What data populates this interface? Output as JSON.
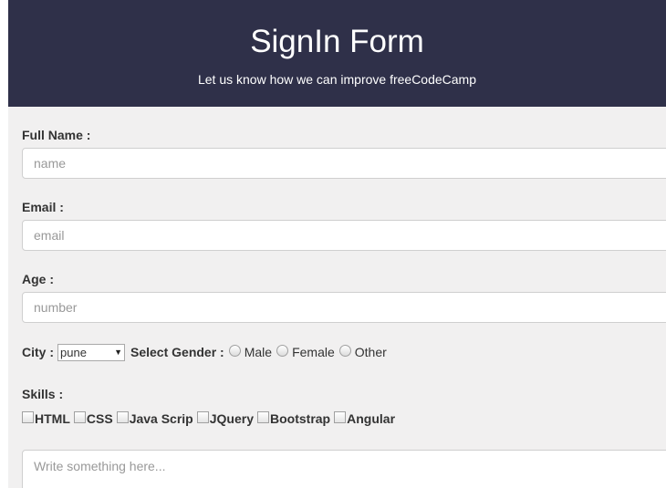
{
  "header": {
    "title": "SignIn Form",
    "subtitle": "Let us know how we can improve freeCodeCamp"
  },
  "form": {
    "full_name": {
      "label": "Full Name :",
      "placeholder": "name",
      "value": ""
    },
    "email": {
      "label": "Email :",
      "placeholder": "email",
      "value": ""
    },
    "age": {
      "label": "Age :",
      "placeholder": "number",
      "value": ""
    },
    "city": {
      "label": "City :",
      "selected": "pune",
      "arrow_icon": "dropdown-arrow-icon"
    },
    "gender": {
      "label": "Select Gender :",
      "options": [
        "Male",
        "Female",
        "Other"
      ]
    },
    "skills": {
      "label": "Skills :",
      "options": [
        "HTML",
        "CSS",
        "Java Scrip",
        "JQuery",
        "Bootstrap",
        "Angular"
      ]
    },
    "comments": {
      "placeholder": "Write something here..."
    }
  },
  "colors": {
    "header_bg": "#2f3049",
    "page_bg": "#f1f0f0",
    "input_border": "#cfcfcf"
  }
}
